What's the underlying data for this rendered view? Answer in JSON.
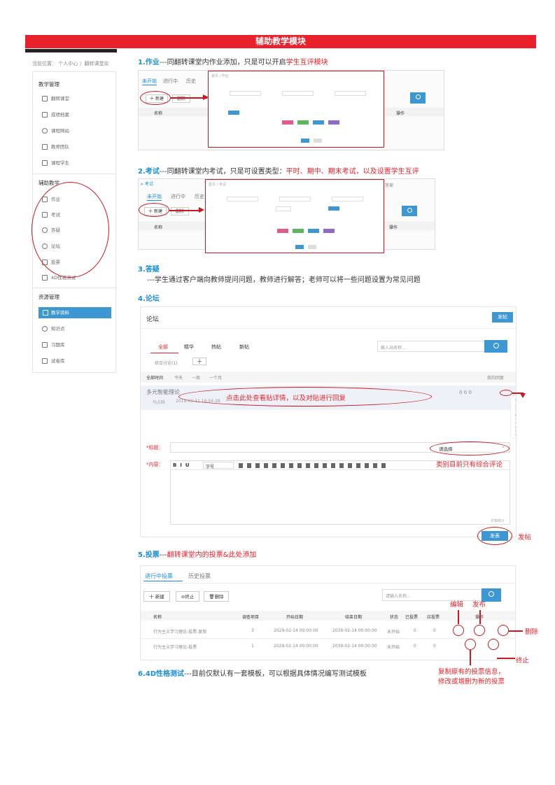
{
  "banner": "辅助教学模块",
  "sidebar": {
    "crumb": "当前位置：  个人中心 〉翻转课堂实",
    "groups": [
      {
        "title": "教学管理",
        "items": [
          "翻转课堂",
          "成绩档案",
          "课程网站",
          "教师团队",
          "课程学生"
        ]
      },
      {
        "title": "辅助教学",
        "items": [
          "作业",
          "考试",
          "答疑",
          "论坛",
          "投票",
          "4D性格测试"
        ]
      },
      {
        "title": "资源管理",
        "items": [
          "教学资料",
          "知识点",
          "习题库",
          "试卷库"
        ]
      }
    ]
  },
  "sections": {
    "s1": {
      "num": "1.作业",
      "dash": "---",
      "text": "同翻转课堂内作业添加，只是可以开启",
      "red": "学生互评模块"
    },
    "s2": {
      "num": "2.考试",
      "dash": "---",
      "text": "同翻转课堂内考试，只是可设置类型：",
      "red": "平时、期中、期末考试，以及设置学生互评"
    },
    "s3": {
      "num": "3.答疑",
      "text": "---学生通过客户端向教师提问问题，教师进行解答；老师可以将一些问题设置为常见问题"
    },
    "s4": {
      "num": "4.论坛"
    },
    "s5": {
      "num": "5.投票",
      "dash": "---",
      "red": "翻转课堂内的投票&此处添加"
    },
    "s6": {
      "num": "6.4D性格测试",
      "dash": "---",
      "text": "目前仅默认有一套模板，可以根据具体情况编写测试模板"
    }
  },
  "hw": {
    "tabs": [
      "未开始",
      "进行中",
      "历史"
    ],
    "new": "十 新建",
    "del": "删除",
    "col_name": "名称",
    "col_op": "操作"
  },
  "exam": {
    "crumb": "> 考试",
    "tabs": [
      "未开始",
      "进行中",
      "历史"
    ],
    "new": "十 新建",
    "del": "删除",
    "col_name": "名称",
    "col_op": "操作",
    "sel": "答案"
  },
  "forum": {
    "title": "论坛",
    "post_btn": "发帖",
    "tabs": [
      "全部",
      "精华",
      "热帖",
      "新帖"
    ],
    "search_ph": "输入站名称...",
    "cat": "综合讨论(1)",
    "add": "十",
    "filters": [
      "全部时间",
      "今天",
      "一周",
      "一个月"
    ],
    "mine": "我的回复",
    "post_title": "多元智能理论",
    "post_author": "马占科",
    "post_date": "2019-02-11 16:54:28",
    "post_stats": "0 0 0",
    "dropdown": [
      "综合",
      "置顶",
      "精华",
      "热帖",
      "删除"
    ],
    "label_title": "*标题：",
    "select": "请选择",
    "label_content": "*内容：",
    "font_size": "字号",
    "counter": "字数统计",
    "submit": "发表"
  },
  "ann": {
    "forum_click": "点击此处查看贴详情，以及对贴进行回复",
    "forum_cat": "类别目前只有综合评论",
    "forum_post": "发帖",
    "edit": "编辑",
    "publish": "发布",
    "delete": "删除",
    "stop": "终止",
    "copy": "复制原有的投票信息，\n修改或增删为新的投票"
  },
  "vote": {
    "tabs": [
      "进行中投票",
      "历史投票"
    ],
    "new": "十 新建",
    "stop": "终止",
    "del": "删除",
    "search_ph": "请输入名称...",
    "cols": [
      "名称",
      "调查项目",
      "开始日期",
      "结束日期",
      "状态",
      "已投票",
      "应投票",
      "操作"
    ],
    "rows": [
      {
        "name": "行为主义学习理论-投票-复制",
        "items": "3",
        "start": "2029-02-14 00:00:00",
        "end": "2039-02-14 00:00:00",
        "status": "未开始",
        "voted": "0",
        "should": "0"
      },
      {
        "name": "行为主义学习理论-投票",
        "items": "1",
        "start": "2029-02-14 00:00:00",
        "end": "2039-02-14 00:00:00",
        "status": "未开始",
        "voted": "0",
        "should": "0"
      }
    ]
  },
  "colors": {
    "red": "#e8212b",
    "blue": "#3d97d3",
    "dark": "#222222"
  }
}
